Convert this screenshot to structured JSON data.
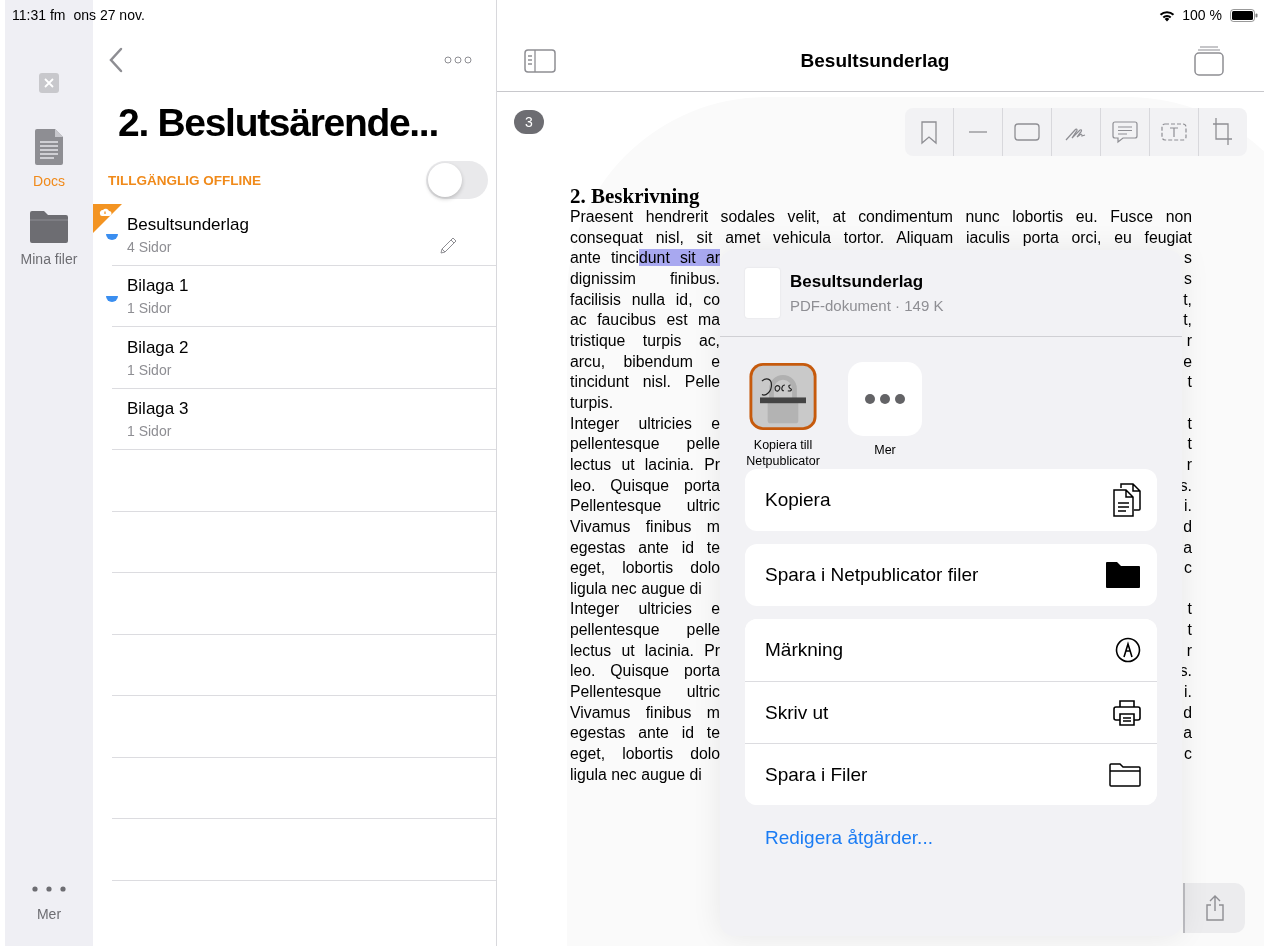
{
  "status_bar": {
    "time": "11:31 fm",
    "date": "ons 27 nov.",
    "battery": "100 %"
  },
  "rail": {
    "items": [
      {
        "label": "Docs",
        "kind": "docs",
        "selected": true
      },
      {
        "label": "Mina filer",
        "kind": "folder",
        "selected": false
      }
    ],
    "more": "Mer"
  },
  "folder": {
    "title": "2. Beslutsärende...",
    "offline": {
      "label": "TILLGÄNGLIG OFFLINE",
      "on": false
    },
    "documents": [
      {
        "name": "Besultsunderlag",
        "pages": "4 Sidor",
        "unread": true,
        "offline_badge": true,
        "editing": true
      },
      {
        "name": "Bilaga 1",
        "pages": "1 Sidor",
        "unread": true,
        "offline_badge": false,
        "editing": false
      },
      {
        "name": "Bilaga 2",
        "pages": "1 Sidor",
        "unread": false,
        "offline_badge": false,
        "editing": false
      },
      {
        "name": "Bilaga 3",
        "pages": "1 Sidor",
        "unread": false,
        "offline_badge": false,
        "editing": false
      }
    ]
  },
  "viewer": {
    "title": "Besultsunderlag",
    "page_badge": "3",
    "document": {
      "heading": "2. Beskrivning",
      "lines": [
        {
          "kind": "full",
          "text": "Praesent hendrerit sodales velit, at condimentum nunc lobortis eu. Fusce non"
        },
        {
          "kind": "full",
          "text": "consequat nisl, sit amet vehicula tortor. Aliquam iaculis porta orci, eu feugiat"
        },
        {
          "kind": "split",
          "left": "ante tinci",
          "highlight": "dunt sit ar",
          "right": "s"
        },
        {
          "kind": "split",
          "left": "dignissim  finibus.",
          "right": "s"
        },
        {
          "kind": "split",
          "left": "facilisis nulla id, co",
          "right": "t,"
        },
        {
          "kind": "split",
          "left": "ac faucibus est ma",
          "right": "t,"
        },
        {
          "kind": "split",
          "left": "tristique turpis ac,",
          "right": "r"
        },
        {
          "kind": "split",
          "left": "arcu, bibendum e",
          "right": "e"
        },
        {
          "kind": "split",
          "left": "tincidunt nisl. Pelle",
          "right": "t"
        },
        {
          "kind": "split",
          "left": "turpis."
        },
        {
          "kind": "split",
          "left": "Integer  ultricies  e",
          "right": "t"
        },
        {
          "kind": "split",
          "left": "pellentesque  pelle",
          "right": "t"
        },
        {
          "kind": "split",
          "left": "lectus ut lacinia. Pr",
          "right": "r"
        },
        {
          "kind": "split",
          "left": "leo. Quisque porta",
          "right": "s."
        },
        {
          "kind": "split",
          "left": "Pellentesque ultric",
          "right": "i."
        },
        {
          "kind": "split",
          "left": "Vivamus finibus m",
          "right": "d"
        },
        {
          "kind": "split",
          "left": "egestas  ante  id  te",
          "right": "a"
        },
        {
          "kind": "split",
          "left": "eget, lobortis dolo",
          "right": "c"
        },
        {
          "kind": "split",
          "left": "ligula nec augue di"
        },
        {
          "kind": "split",
          "left": "Integer  ultricies  e",
          "right": "t"
        },
        {
          "kind": "split",
          "left": "pellentesque  pelle",
          "right": "t"
        },
        {
          "kind": "split",
          "left": "lectus ut lacinia. Pr",
          "right": "r"
        },
        {
          "kind": "split",
          "left": "leo. Quisque porta",
          "right": "s."
        },
        {
          "kind": "split",
          "left": "Pellentesque ultric",
          "right": "i."
        },
        {
          "kind": "split",
          "left": "Vivamus finibus m",
          "right": "d"
        },
        {
          "kind": "split",
          "left": "egestas  ante  id  te",
          "right": "a"
        },
        {
          "kind": "split",
          "left": "eget, lobortis dolo",
          "right": "c"
        },
        {
          "kind": "split",
          "left": "ligula nec augue di"
        }
      ]
    }
  },
  "share_sheet": {
    "file": {
      "name": "Besultsunderlag",
      "meta": "PDF-dokument · 149 K"
    },
    "apps": [
      {
        "kind": "app",
        "label": "Kopiera till Netpublicator"
      },
      {
        "kind": "more",
        "label": "Mer"
      }
    ],
    "action_groups": [
      [
        {
          "label": "Kopiera",
          "kind": "copy"
        }
      ],
      [
        {
          "label": "Spara i Netpublicator filer",
          "kind": "folder-filled"
        }
      ],
      [
        {
          "label": "Märkning",
          "kind": "markup"
        },
        {
          "label": "Skriv ut",
          "kind": "print"
        },
        {
          "label": "Spara i Filer",
          "kind": "folder"
        }
      ]
    ],
    "edit_link": "Redigera åtgärder..."
  }
}
